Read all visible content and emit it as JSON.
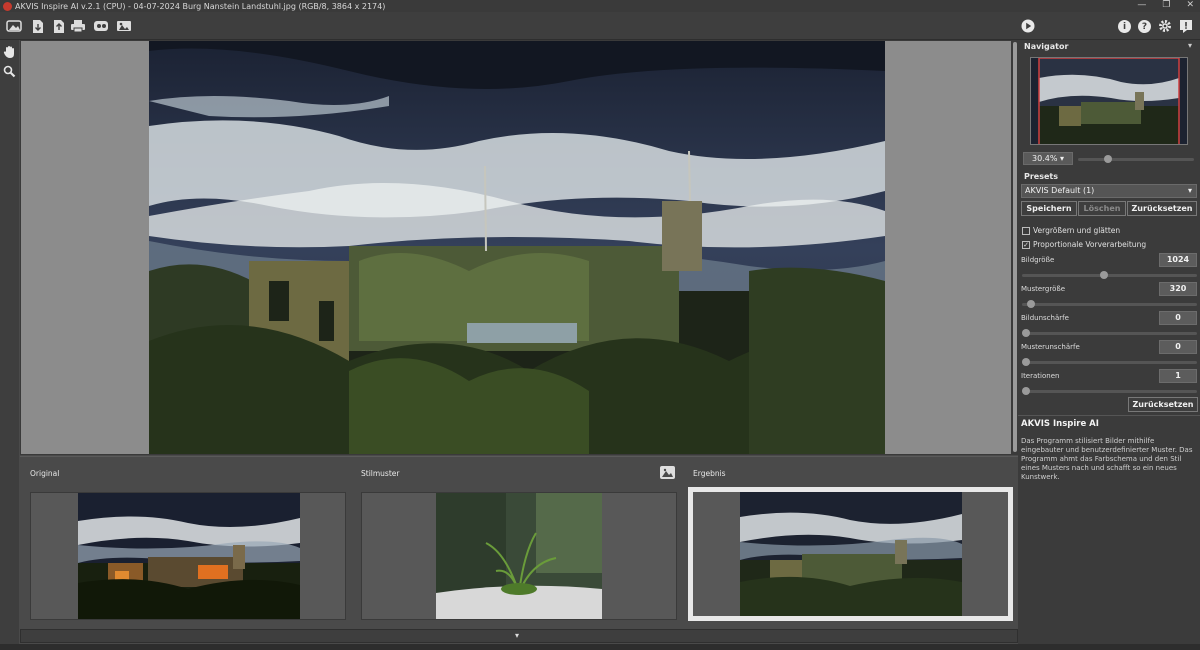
{
  "window": {
    "title": "AKVIS Inspire AI v.2.1 (CPU) - 04-07-2024 Burg Nanstein Landstuhl.jpg (RGB/8, 3864 x 2174)",
    "controls": [
      "—",
      "❐",
      "✕"
    ]
  },
  "toolbar": {
    "left_icons": [
      "open-icon",
      "import-icon",
      "export-icon",
      "print-icon",
      "share-icon",
      "image-icon"
    ],
    "right_icons": [
      "run-icon",
      "info-icon",
      "help-icon",
      "settings-icon",
      "notification-icon"
    ],
    "info_glyph": "i",
    "help_glyph": "?"
  },
  "tools": [
    "hand-tool-icon",
    "zoom-tool-icon"
  ],
  "thumbnails": {
    "original_label": "Original",
    "style_label": "Stilmuster",
    "result_label": "Ergebnis"
  },
  "bottom": {
    "toggle_glyph": "▾"
  },
  "navigator": {
    "title": "Navigator",
    "zoom_value": "30.4%",
    "zoom_level": 0.26
  },
  "presets": {
    "title": "Presets",
    "selected": "AKVIS Default (1)",
    "save_label": "Speichern",
    "delete_label": "Löschen",
    "reset_label": "Zurücksetzen"
  },
  "options": {
    "enlarge_smooth": {
      "label": "Vergrößern und glätten",
      "checked": false
    },
    "proportional": {
      "label": "Proportionale Vorverarbeitung",
      "checked": true
    }
  },
  "params": [
    {
      "label": "Bildgröße",
      "value": "1024",
      "level": 0.47
    },
    {
      "label": "Mustergröße",
      "value": "320",
      "level": 0.05
    },
    {
      "label": "Bildunschärfe",
      "value": "0",
      "level": 0.0
    },
    {
      "label": "Musterunschärfe",
      "value": "0",
      "level": 0.0
    },
    {
      "label": "Iterationen",
      "value": "1",
      "level": 0.0
    }
  ],
  "params_reset_label": "Zurücksetzen",
  "info": {
    "title": "AKVIS Inspire AI",
    "text": "Das Programm stilisiert Bilder mithilfe eingebauter und benutzerdefinierter Muster. Das Programm ahmt das Farbschema und den Stil eines Musters nach und schafft so ein neues Kunstwerk."
  }
}
